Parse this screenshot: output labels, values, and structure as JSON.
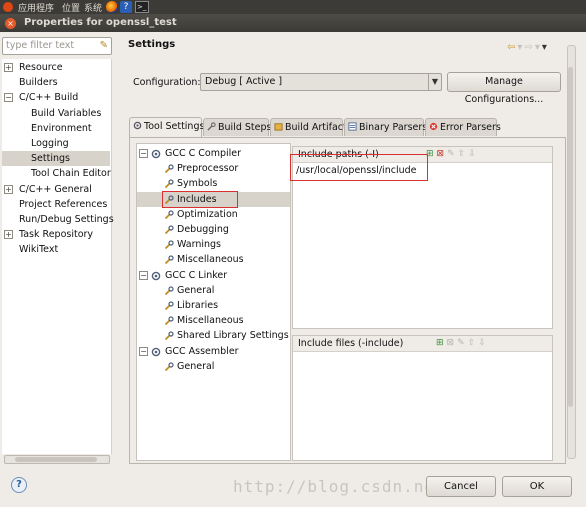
{
  "system_bar": {
    "menus": [
      "应用程序",
      "位置",
      "系统"
    ]
  },
  "window": {
    "title": "Properties for openssl_test"
  },
  "sidebar": {
    "filter_placeholder": "type filter text",
    "items": [
      {
        "label": "Resource",
        "expander": "+",
        "indent": 0
      },
      {
        "label": "Builders",
        "expander": "",
        "indent": 0
      },
      {
        "label": "C/C++ Build",
        "expander": "−",
        "indent": 0
      },
      {
        "label": "Build Variables",
        "expander": "",
        "indent": 1
      },
      {
        "label": "Environment",
        "expander": "",
        "indent": 1
      },
      {
        "label": "Logging",
        "expander": "",
        "indent": 1
      },
      {
        "label": "Settings",
        "expander": "",
        "indent": 1,
        "selected": true
      },
      {
        "label": "Tool Chain Editor",
        "expander": "",
        "indent": 1
      },
      {
        "label": "C/C++ General",
        "expander": "+",
        "indent": 0
      },
      {
        "label": "Project References",
        "expander": "",
        "indent": 0
      },
      {
        "label": "Run/Debug Settings",
        "expander": "",
        "indent": 0
      },
      {
        "label": "Task Repository",
        "expander": "+",
        "indent": 0
      },
      {
        "label": "WikiText",
        "expander": "",
        "indent": 0
      }
    ]
  },
  "main": {
    "heading": "Settings",
    "configuration_label": "Configuration:",
    "configuration_value": "Debug  [ Active ]",
    "manage_button": "Manage Configurations...",
    "tabs": [
      {
        "label": "Tool Settings",
        "active": true,
        "icon": "tool-settings-icon"
      },
      {
        "label": "Build Steps",
        "active": false,
        "icon": "wrench-icon"
      },
      {
        "label": "Build Artifact",
        "active": false,
        "icon": "artifact-icon"
      },
      {
        "label": "Binary Parsers",
        "active": false,
        "icon": "binary-icon"
      },
      {
        "label": "Error Parsers",
        "active": false,
        "icon": "error-icon"
      }
    ],
    "tool_tree": [
      {
        "label": "GCC C Compiler",
        "kind": "group",
        "expander": "−"
      },
      {
        "label": "Preprocessor",
        "kind": "child"
      },
      {
        "label": "Symbols",
        "kind": "child"
      },
      {
        "label": "Includes",
        "kind": "child",
        "selected": true
      },
      {
        "label": "Optimization",
        "kind": "child"
      },
      {
        "label": "Debugging",
        "kind": "child"
      },
      {
        "label": "Warnings",
        "kind": "child"
      },
      {
        "label": "Miscellaneous",
        "kind": "child"
      },
      {
        "label": "GCC C Linker",
        "kind": "group",
        "expander": "−"
      },
      {
        "label": "General",
        "kind": "child"
      },
      {
        "label": "Libraries",
        "kind": "child"
      },
      {
        "label": "Miscellaneous",
        "kind": "child"
      },
      {
        "label": "Shared Library Settings",
        "kind": "child"
      },
      {
        "label": "GCC Assembler",
        "kind": "group",
        "expander": "−"
      },
      {
        "label": "General",
        "kind": "child"
      }
    ],
    "include_paths": {
      "title": "Include paths (-I)",
      "values": [
        "/usr/local/openssl/include"
      ]
    },
    "include_files": {
      "title": "Include files (-include)",
      "values": []
    }
  },
  "footer": {
    "cancel": "Cancel",
    "ok": "OK",
    "watermark": "http://blog.csdn.net"
  },
  "colors": {
    "selection": "#d7d3cb",
    "highlight_box": "#d83030",
    "titlebar": "#3c3b37"
  }
}
